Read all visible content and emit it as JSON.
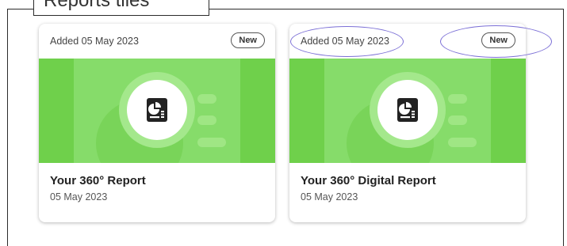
{
  "section": {
    "label": "Reports tiles"
  },
  "cards": [
    {
      "added": "Added 05 May 2023",
      "badge": "New",
      "title": "Your 360° Report",
      "date": "05 May 2023",
      "icon": "report-icon"
    },
    {
      "added": "Added 05 May 2023",
      "badge": "New",
      "title": "Your 360° Digital Report",
      "date": "05 May 2023",
      "icon": "report-icon"
    }
  ],
  "colors": {
    "banner": "#86dc6a",
    "banner_band": "#6fd04b",
    "highlight_oval": "#7b6fd6"
  }
}
